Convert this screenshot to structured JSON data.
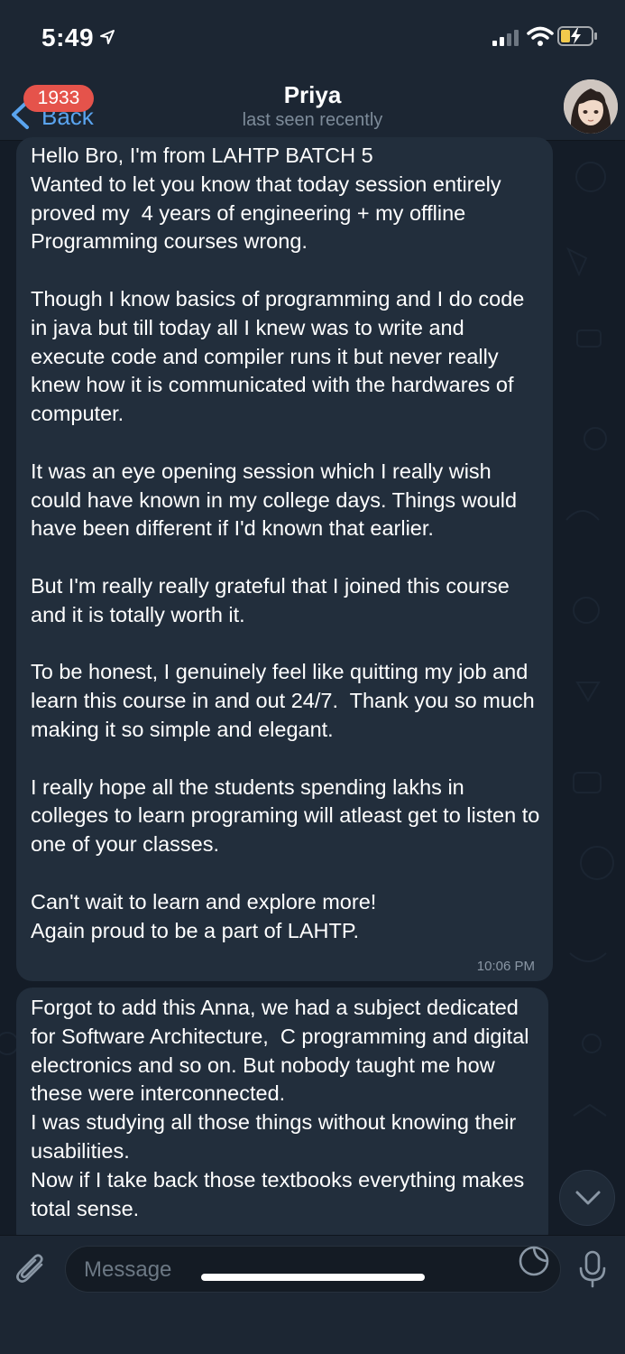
{
  "status_bar": {
    "time": "5:49",
    "icons": [
      "location-arrow-icon",
      "signal-icon",
      "wifi-icon",
      "battery-charging-icon"
    ]
  },
  "header": {
    "back_label": "Back",
    "unread_count": "1933",
    "contact_name": "Priya",
    "contact_status": "last seen recently",
    "avatar_icon": "anime-avatar"
  },
  "messages": [
    {
      "text": "Hello Bro, I'm from LAHTP BATCH 5\nWanted to let you know that today session entirely proved my  4 years of engineering + my offline Programming courses wrong.\n\nThough I know basics of programming and I do code in java but till today all I knew was to write and execute code and compiler runs it but never really knew how it is communicated with the hardwares of computer.\n\nIt was an eye opening session which I really wish could have known in my college days. Things would have been different if I'd known that earlier.\n\nBut I'm really really grateful that I joined this course and it is totally worth it.\n\nTo be honest, I genuinely feel like quitting my job and learn this course in and out 24/7.  Thank you so much making it so simple and elegant.\n\nI really hope all the students spending lakhs in colleges to learn programing will atleast get to listen to one of your classes.\n\nCan't wait to learn and explore more!\nAgain proud to be a part of LAHTP.",
      "time": "10:06 PM"
    },
    {
      "text": "Forgot to add this Anna, we had a subject dedicated for Software Architecture,  C programming and digital electronics and so on. But nobody taught me how these were interconnected.\nI was studying all those things without knowing their usabilities.\nNow if I take back those textbooks everything makes total sense."
    }
  ],
  "input": {
    "placeholder": "Message"
  },
  "colors": {
    "background": "#151d28",
    "bar": "#1c2633",
    "bubble": "#222e3c",
    "accent": "#5aa4ef",
    "badge": "#e5534b"
  }
}
